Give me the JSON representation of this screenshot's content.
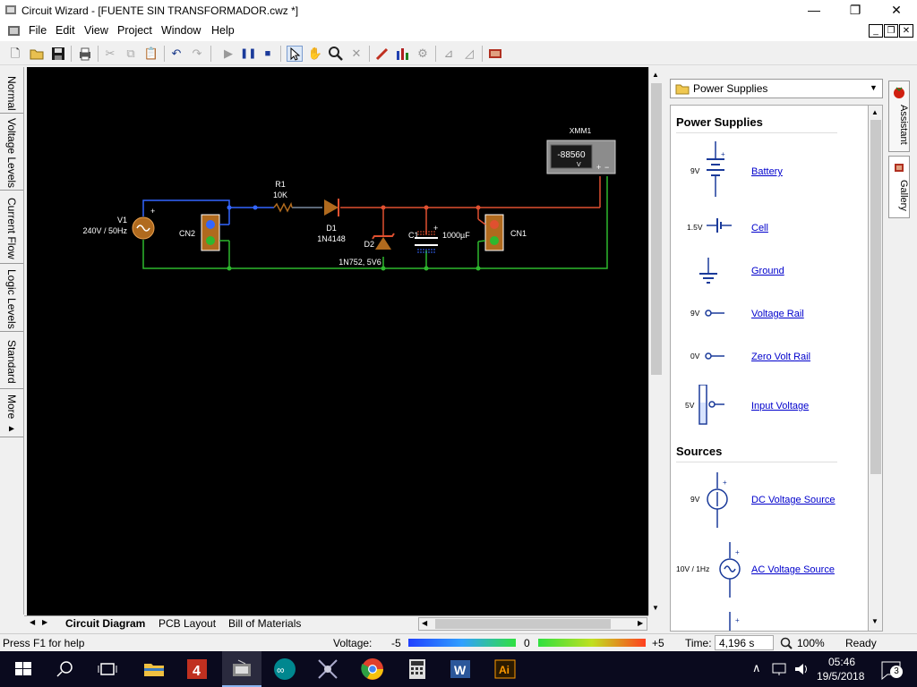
{
  "window": {
    "title": "Circuit Wizard - [FUENTE SIN TRANSFORMADOR.cwz *]"
  },
  "menu": {
    "items": [
      "File",
      "Edit",
      "View",
      "Project",
      "Window",
      "Help"
    ]
  },
  "left_tabs": [
    "Normal",
    "Voltage Levels",
    "Current Flow",
    "Logic Levels",
    "Standard",
    "More ▸"
  ],
  "circuit": {
    "v1_label": "V1",
    "v1_value": "240V / 50Hz",
    "cn2": "CN2",
    "cn1": "CN1",
    "r1_label": "R1",
    "r1_value": "10K",
    "d1_label": "D1",
    "d1_value": "1N4148",
    "d2_label": "D2",
    "d2_value": "1N752, 5V6",
    "c1_label": "C1",
    "c1_value": "1000µF",
    "xmm1_label": "XMM1",
    "xmm1_display": "-88560",
    "xmm1_unit": "V",
    "plus": "+",
    "minus": "−"
  },
  "bottom_tabs": [
    "Circuit Diagram",
    "PCB Layout",
    "Bill of Materials"
  ],
  "gallery": {
    "dropdown": "Power Supplies",
    "sections": [
      {
        "title": "Power Supplies",
        "items": [
          {
            "label": "Battery",
            "value": "9V"
          },
          {
            "label": "Cell",
            "value": "1.5V"
          },
          {
            "label": "Ground",
            "value": ""
          },
          {
            "label": "Voltage Rail",
            "value": "9V"
          },
          {
            "label": "Zero Volt Rail",
            "value": "0V"
          },
          {
            "label": "Input Voltage",
            "value": "5V"
          }
        ]
      },
      {
        "title": "Sources",
        "items": [
          {
            "label": "DC Voltage Source",
            "value": "9V"
          },
          {
            "label": "AC Voltage Source",
            "value": "10V / 1Hz"
          }
        ]
      }
    ]
  },
  "side_tabs": [
    "Assistant",
    "Gallery"
  ],
  "status": {
    "help": "Press F1 for help",
    "voltage_label": "Voltage:",
    "v_min": "-5",
    "v_mid": "0",
    "v_max": "+5",
    "time_label": "Time:",
    "time_value": "4,196 s",
    "zoom": "100%",
    "state": "Ready"
  },
  "taskbar": {
    "time": "05:46",
    "date": "19/5/2018",
    "notifications": "3"
  },
  "colors": {
    "positive": "#e05030",
    "negative": "#2eb82e",
    "neutral": "#3366ff",
    "component": "#b06a1e"
  }
}
